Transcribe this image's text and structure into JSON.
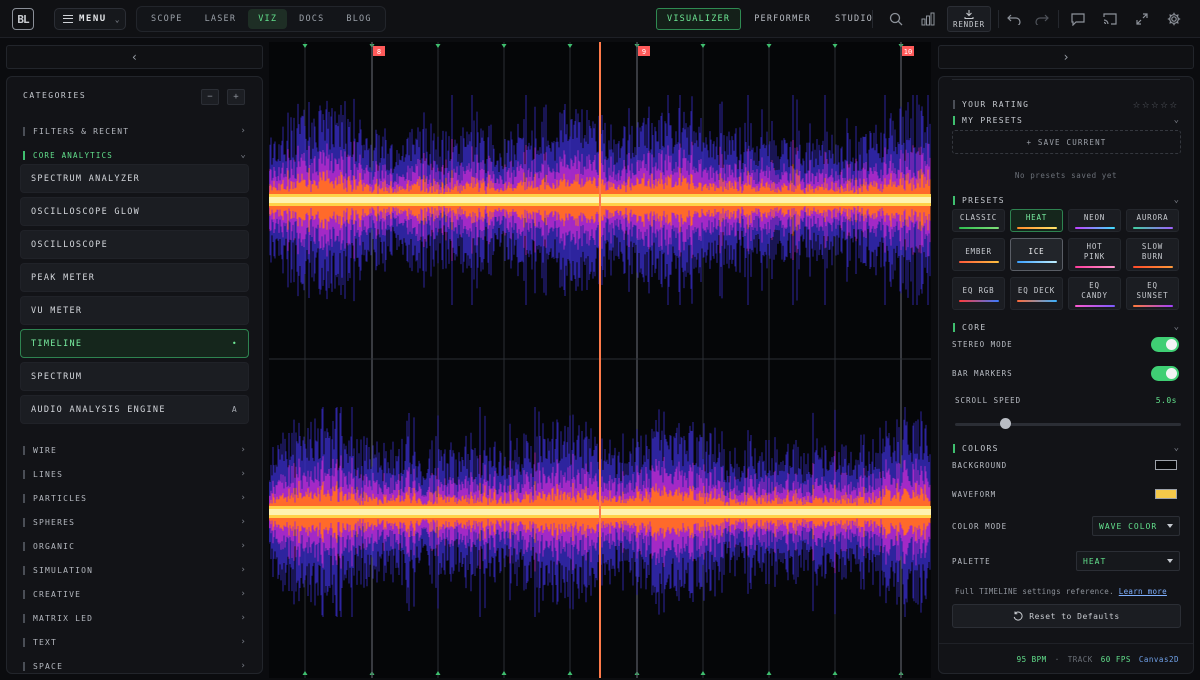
{
  "app": {
    "logo_text": "BL"
  },
  "topbar": {
    "menu_label": "MENU",
    "nav": [
      {
        "label": "SCOPE",
        "active": false
      },
      {
        "label": "LASER",
        "active": false
      },
      {
        "label": "VIZ",
        "active": true
      },
      {
        "label": "DOCS",
        "active": false
      },
      {
        "label": "BLOG",
        "active": false
      }
    ],
    "modes": [
      {
        "label": "VISUALIZER",
        "active": true
      },
      {
        "label": "PERFORMER",
        "active": false
      },
      {
        "label": "STUDIO",
        "active": false
      }
    ],
    "render_label": "RENDER",
    "icons": [
      "search-icon",
      "bar-chart-icon",
      "download-icon",
      "undo-icon",
      "redo-icon",
      "chat-icon",
      "cast-icon",
      "fullscreen-icon",
      "gear-icon"
    ]
  },
  "left": {
    "heading": "CATEGORIES",
    "minus": "−",
    "plus": "+",
    "groups_top": [
      {
        "label": "FILTERS & RECENT"
      }
    ],
    "open_group": "CORE ANALYTICS",
    "items": [
      {
        "label": "SPECTRUM ANALYZER",
        "badge": "",
        "active": false
      },
      {
        "label": "OSCILLOSCOPE GLOW",
        "badge": "",
        "active": false
      },
      {
        "label": "OSCILLOSCOPE",
        "badge": "",
        "active": false
      },
      {
        "label": "PEAK METER",
        "badge": "",
        "active": false
      },
      {
        "label": "VU METER",
        "badge": "",
        "active": false
      },
      {
        "label": "TIMELINE",
        "badge": "•",
        "active": true
      },
      {
        "label": "SPECTRUM",
        "badge": "",
        "active": false
      },
      {
        "label": "AUDIO ANALYSIS ENGINE",
        "badge": "A",
        "active": false
      }
    ],
    "groups": [
      "WIRE",
      "LINES",
      "PARTICLES",
      "SPHERES",
      "ORGANIC",
      "SIMULATION",
      "CREATIVE",
      "MATRIX LED",
      "TEXT",
      "SPACE"
    ]
  },
  "canvas": {
    "bar_markers": [
      {
        "label": "8"
      },
      {
        "label": "9"
      },
      {
        "label": "10"
      }
    ]
  },
  "right": {
    "rating_label": "YOUR RATING",
    "rating_value": 0,
    "rating_max": 5,
    "my_presets": "MY PRESETS",
    "save_current": "+ SAVE CURRENT",
    "no_presets": "No presets saved yet",
    "presets_heading": "PRESETS",
    "presets": [
      {
        "label": "CLASSIC",
        "state": "",
        "colors": [
          "#2fbf4f",
          "#7fe07a"
        ]
      },
      {
        "label": "HEAT",
        "state": "active",
        "colors": [
          "#ff8a2a",
          "#ffe66a"
        ]
      },
      {
        "label": "NEON",
        "state": "",
        "colors": [
          "#c040ff",
          "#40e0ff"
        ]
      },
      {
        "label": "AURORA",
        "state": "",
        "colors": [
          "#40d0a0",
          "#a060ff"
        ]
      },
      {
        "label": "EMBER",
        "state": "",
        "colors": [
          "#ff5a3a",
          "#ffc040"
        ]
      },
      {
        "label": "ICE",
        "state": "sel",
        "colors": [
          "#3aa0ff",
          "#c0f0ff"
        ]
      },
      {
        "label": "HOT PINK",
        "state": "",
        "colors": [
          "#ff3a9a",
          "#ff9ad0"
        ]
      },
      {
        "label": "SLOW BURN",
        "state": "",
        "colors": [
          "#ff4a2a",
          "#ff9a3a"
        ]
      },
      {
        "label": "EQ RGB",
        "state": "",
        "colors": [
          "#ff3a3a",
          "#3a7aff"
        ]
      },
      {
        "label": "EQ DECK",
        "state": "",
        "colors": [
          "#ff6a3a",
          "#3ab0ff"
        ]
      },
      {
        "label": "EQ CANDY",
        "state": "",
        "colors": [
          "#ff5ad0",
          "#7a5aff"
        ]
      },
      {
        "label": "EQ SUNSET",
        "state": "",
        "colors": [
          "#ff7a3a",
          "#a040ff"
        ]
      }
    ],
    "core_heading": "CORE",
    "stereo_mode": "STEREO MODE",
    "stereo_on": true,
    "bar_markers": "BAR MARKERS",
    "bar_markers_on": true,
    "scroll_speed_label": "SCROLL SPEED",
    "scroll_speed_value": "5.0s",
    "scroll_speed_fraction": 0.22,
    "colors_heading": "COLORS",
    "background_label": "BACKGROUND",
    "background_color": "#050608",
    "waveform_label": "WAVEFORM",
    "waveform_color": "#f5c94a",
    "color_mode_label": "COLOR MODE",
    "color_mode_value": "WAVE COLOR",
    "palette_label": "PALETTE",
    "palette_value": "HEAT",
    "ref_text": "Full TIMELINE settings reference.",
    "ref_link": "Learn more",
    "reset_label": "Reset to Defaults",
    "footer": {
      "bpm": "95 BPM",
      "sep": "·",
      "track": "TRACK",
      "fps": "60 FPS",
      "renderer": "Canvas2D"
    }
  }
}
